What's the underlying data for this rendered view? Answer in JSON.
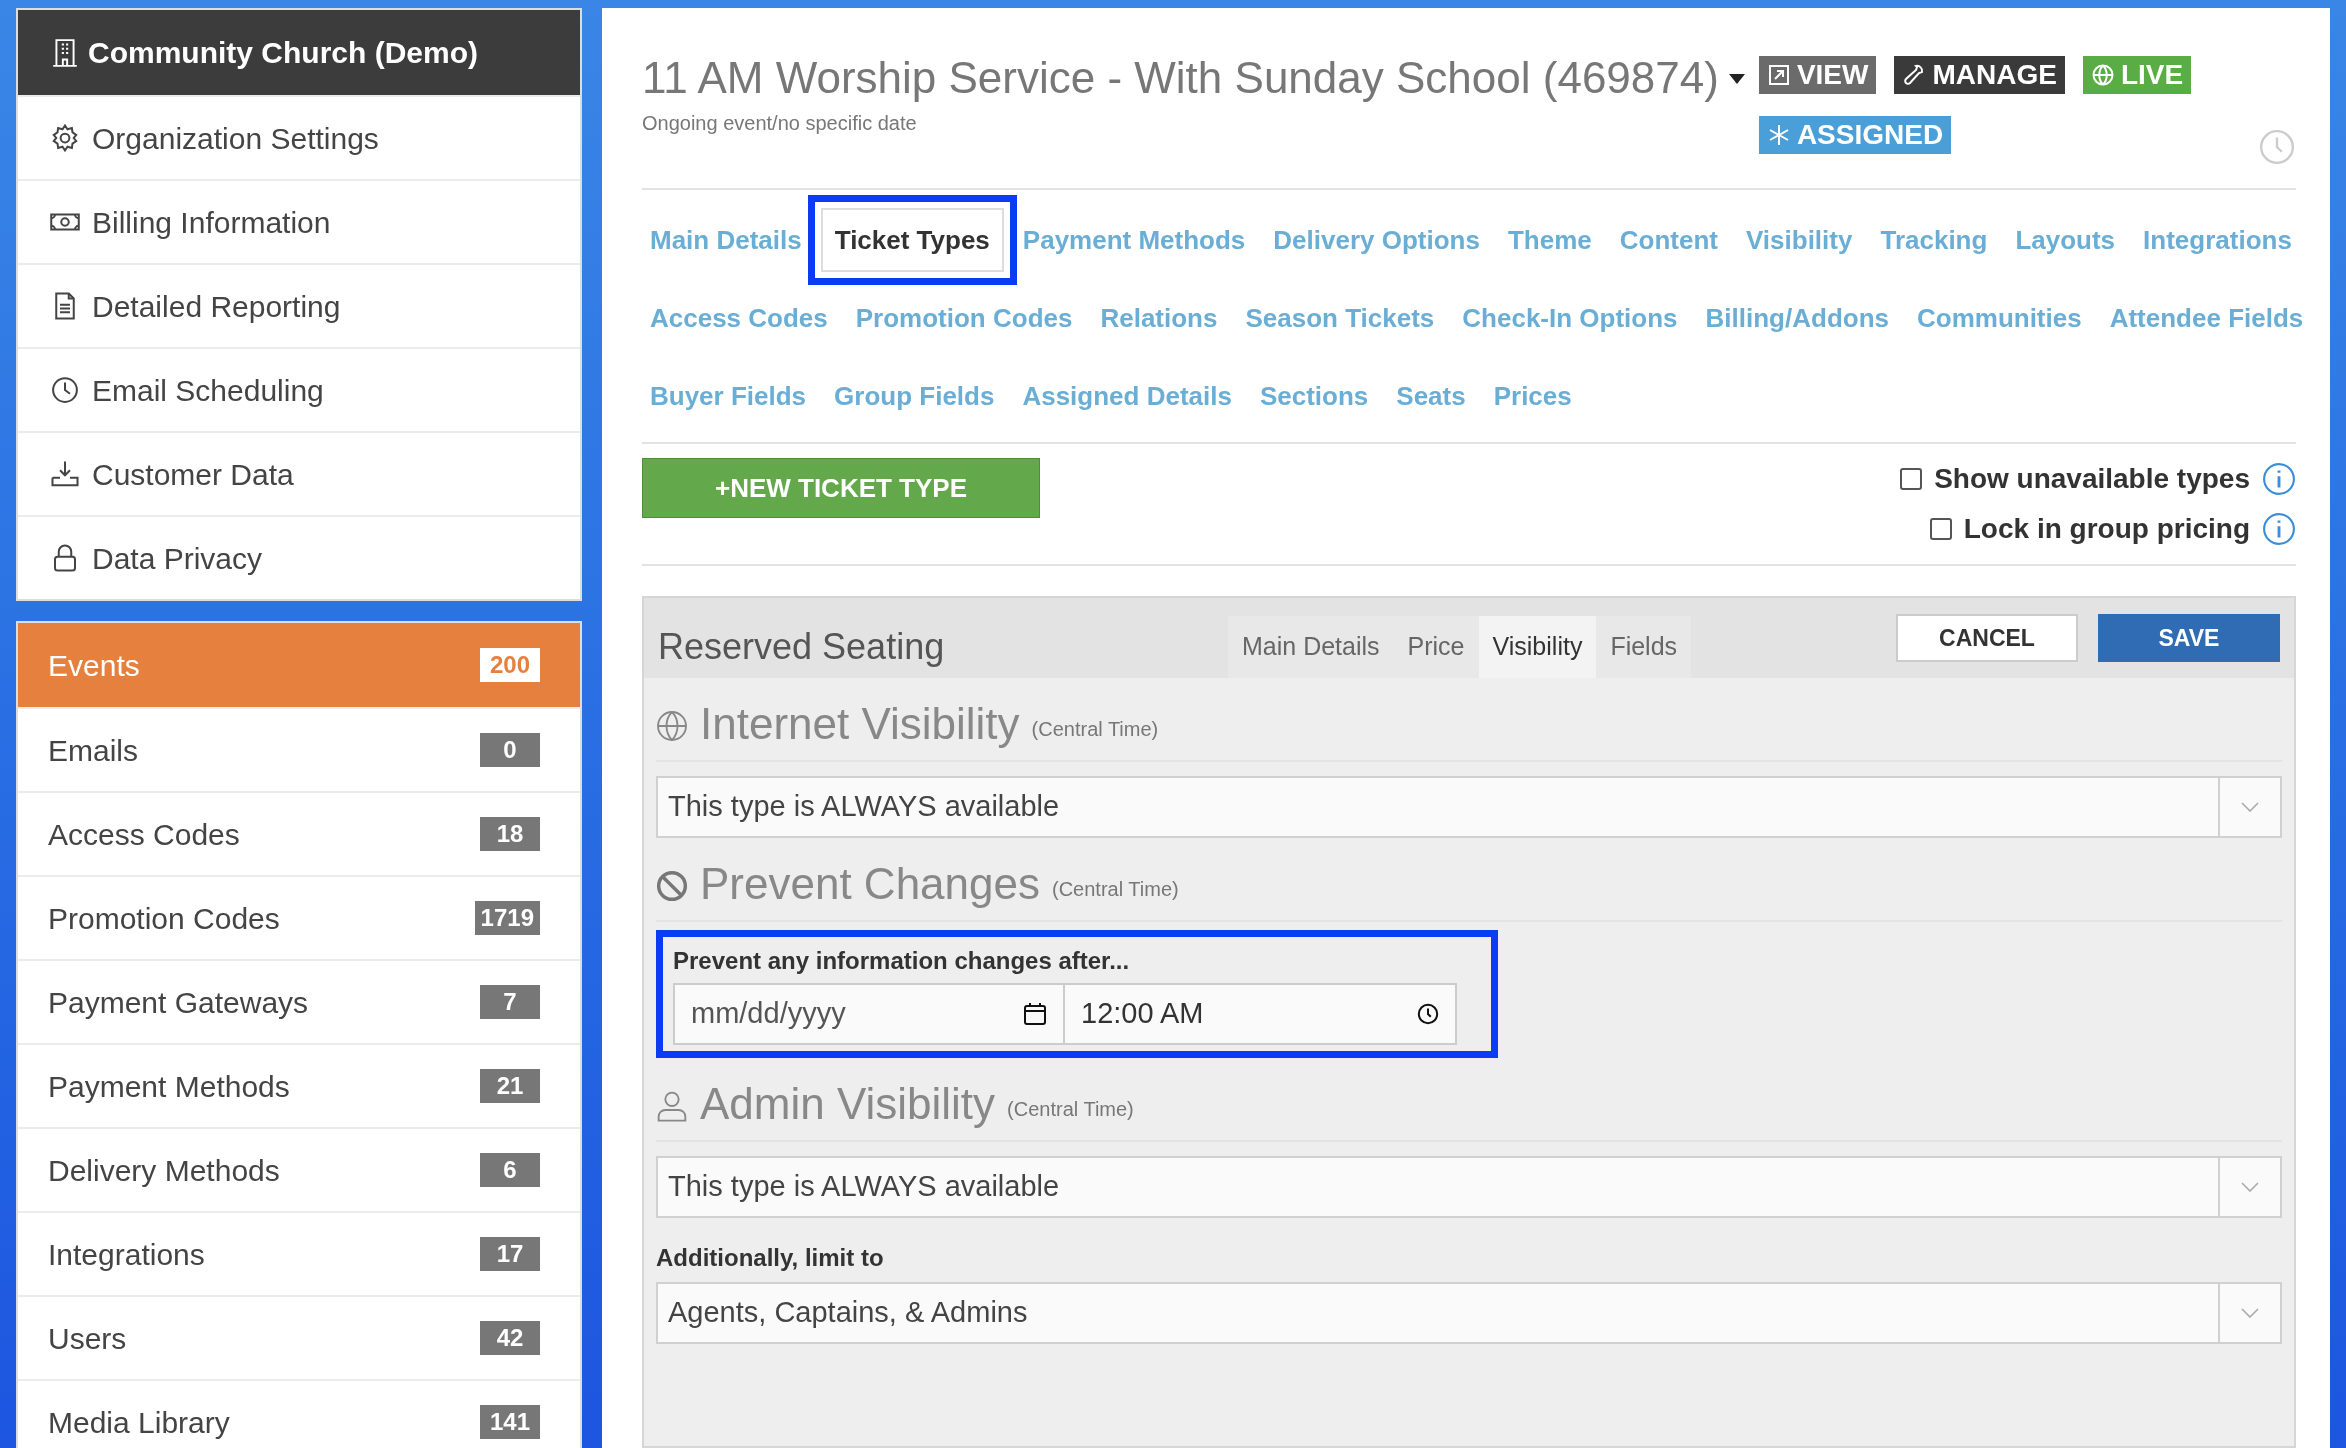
{
  "organization": {
    "title": "Community Church (Demo)",
    "items": [
      {
        "label": "Organization Settings"
      },
      {
        "label": "Billing Information"
      },
      {
        "label": "Detailed Reporting"
      },
      {
        "label": "Email Scheduling"
      },
      {
        "label": "Customer Data"
      },
      {
        "label": "Data Privacy"
      }
    ]
  },
  "nav": [
    {
      "label": "Events",
      "count": "200",
      "selected": true
    },
    {
      "label": "Emails",
      "count": "0",
      "selected": false
    },
    {
      "label": "Access Codes",
      "count": "18",
      "selected": false
    },
    {
      "label": "Promotion Codes",
      "count": "1719",
      "selected": false
    },
    {
      "label": "Payment Gateways",
      "count": "7",
      "selected": false
    },
    {
      "label": "Payment Methods",
      "count": "21",
      "selected": false
    },
    {
      "label": "Delivery Methods",
      "count": "6",
      "selected": false
    },
    {
      "label": "Integrations",
      "count": "17",
      "selected": false
    },
    {
      "label": "Users",
      "count": "42",
      "selected": false
    },
    {
      "label": "Media Library",
      "count": "141",
      "selected": false
    }
  ],
  "event": {
    "title": "11 AM Worship Service - With Sunday School (469874)",
    "subtitle": "Ongoing event/no specific date",
    "badges": [
      {
        "label": "VIEW",
        "kind": "view"
      },
      {
        "label": "MANAGE",
        "kind": "manage"
      },
      {
        "label": "LIVE",
        "kind": "live"
      },
      {
        "label": "ASSIGNED",
        "kind": "assigned"
      }
    ]
  },
  "tab_rows": [
    [
      {
        "label": "Main Details",
        "selected": false,
        "highlighted": false
      },
      {
        "label": "Ticket Types",
        "selected": true,
        "highlighted": true
      },
      {
        "label": "Payment Methods",
        "selected": false,
        "highlighted": false
      },
      {
        "label": "Delivery Options",
        "selected": false,
        "highlighted": false
      },
      {
        "label": "Theme",
        "selected": false,
        "highlighted": false
      },
      {
        "label": "Content",
        "selected": false,
        "highlighted": false
      },
      {
        "label": "Visibility",
        "selected": false,
        "highlighted": false
      },
      {
        "label": "Tracking",
        "selected": false,
        "highlighted": false
      },
      {
        "label": "Layouts",
        "selected": false,
        "highlighted": false
      },
      {
        "label": "Integrations",
        "selected": false,
        "highlighted": false
      }
    ],
    [
      {
        "label": "Access Codes",
        "selected": false,
        "highlighted": false
      },
      {
        "label": "Promotion Codes",
        "selected": false,
        "highlighted": false
      },
      {
        "label": "Relations",
        "selected": false,
        "highlighted": false
      },
      {
        "label": "Season Tickets",
        "selected": false,
        "highlighted": false
      },
      {
        "label": "Check-In Options",
        "selected": false,
        "highlighted": false
      },
      {
        "label": "Billing/Addons",
        "selected": false,
        "highlighted": false
      },
      {
        "label": "Communities",
        "selected": false,
        "highlighted": false
      },
      {
        "label": "Attendee Fields",
        "selected": false,
        "highlighted": false
      }
    ],
    [
      {
        "label": "Buyer Fields",
        "selected": false,
        "highlighted": false
      },
      {
        "label": "Group Fields",
        "selected": false,
        "highlighted": false
      },
      {
        "label": "Assigned Details",
        "selected": false,
        "highlighted": false
      },
      {
        "label": "Sections",
        "selected": false,
        "highlighted": false
      },
      {
        "label": "Seats",
        "selected": false,
        "highlighted": false
      },
      {
        "label": "Prices",
        "selected": false,
        "highlighted": false
      }
    ]
  ],
  "new_button": "+NEW TICKET TYPE",
  "options": [
    {
      "label": "Show unavailable types",
      "checked": false
    },
    {
      "label": "Lock in group pricing",
      "checked": false
    }
  ],
  "panel": {
    "title": "Reserved Seating",
    "tabs": [
      {
        "label": "Main Details",
        "selected": false
      },
      {
        "label": "Price",
        "selected": false
      },
      {
        "label": "Visibility",
        "selected": true
      },
      {
        "label": "Fields",
        "selected": false
      }
    ],
    "cancel": "CANCEL",
    "save": "SAVE",
    "sections": [
      {
        "kind": "select",
        "heading": "Internet Visibility",
        "note": "(Central Time)",
        "value": "This type is ALWAYS available"
      },
      {
        "kind": "datetime",
        "heading": "Prevent Changes",
        "note": "(Central Time)",
        "label": "Prevent any information changes after...",
        "date_placeholder": "mm/dd/yyyy",
        "time": "12:00 AM",
        "highlighted": true
      },
      {
        "kind": "select",
        "heading": "Admin Visibility",
        "note": "(Central Time)",
        "value": "This type is ALWAYS available",
        "extra_label": "Additionally, limit to",
        "extra_value": "Agents, Captains, & Admins"
      }
    ]
  }
}
